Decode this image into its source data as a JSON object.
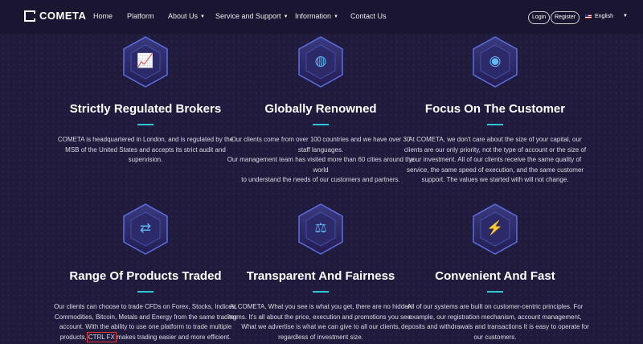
{
  "brand": {
    "name": "COMETA"
  },
  "nav": {
    "items": [
      {
        "label": "Home"
      },
      {
        "label": "Platform"
      },
      {
        "label": "About Us"
      },
      {
        "label": "Service and Support"
      },
      {
        "label": "Information"
      },
      {
        "label": "Contact Us"
      }
    ],
    "login_label": "Login",
    "register_label": "Register",
    "language": "English"
  },
  "colors": {
    "background": "#201a3c",
    "navbar": "#1a1530",
    "accent": "#2ec7d8",
    "icon": "#5fb8f0",
    "highlight_border": "#e33333"
  },
  "features": [
    {
      "icon": "heartbeat-monitor-icon",
      "title": "Strictly Regulated Brokers",
      "desc": "COMETA is headquartered in London, and is regulated by the MSB of the United States and accepts its strict audit and supervision."
    },
    {
      "icon": "globe-icon",
      "title": "Globally Renowned",
      "desc_lines": [
        "Our clients come from over 100 countries and we have over 30 staff languages.",
        "Our management team has visited more than 60 cities around the world",
        "to understand the needs of our customers and partners."
      ]
    },
    {
      "icon": "target-icon",
      "title": "Focus On The Customer",
      "desc": "At COMETA, we don't care about the size of your capital, our clients are our only priority, not the type of account or the size of your investment. All of our clients receive the same quality of service, the same speed of execution, and the same customer support. The values we started with will not change."
    },
    {
      "icon": "exchange-arrows-icon",
      "title": "Range Of Products Traded",
      "desc_before": "Our clients can choose to trade CFDs on Forex, Stocks, Indices, Commodities, Bitcoin, Metals and Energy from the same trading account. With the ability to use one platform to trade multiple products,",
      "desc_highlight": "CTRL FX",
      "desc_after": "makes trading easier and more efficient."
    },
    {
      "icon": "balance-scale-icon",
      "title": "Transparent And Fairness",
      "desc": "At COMETA, What you see is what you get, there are no hidden terms. It's all about the price, execution and promotions you see. What we advertise is what we can give to all our clients, regardless of investment size."
    },
    {
      "icon": "lightning-bolt-icon",
      "title": "Convenient And Fast",
      "desc": "All of our systems are built on customer-centric principles. For example, our registration mechanism, account management, deposits and withdrawals and transactions It is easy to operate for our customers."
    }
  ]
}
